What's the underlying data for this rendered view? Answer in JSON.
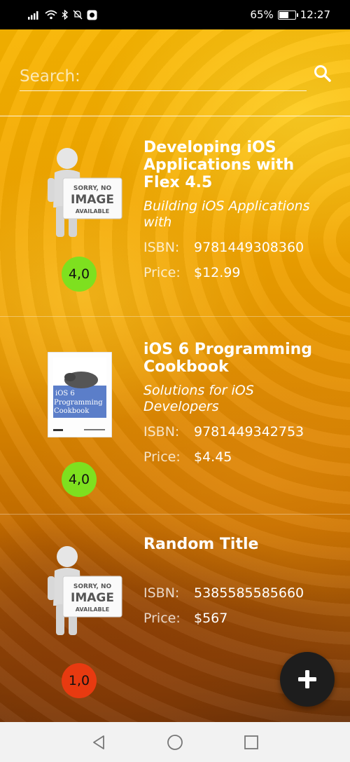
{
  "status_bar": {
    "battery": "65%",
    "battery_level": 0.65,
    "time": "12:27",
    "icons": [
      "signal-icon",
      "wifi-icon",
      "bluetooth-icon",
      "mute-icon",
      "app-notification-icon"
    ]
  },
  "search": {
    "placeholder": "Search:"
  },
  "books": [
    {
      "title": "Developing iOS Applications with Flex 4.5",
      "subtitle": "Building iOS Applications with",
      "isbn_label": "ISBN:",
      "isbn": "9781449308360",
      "price_label": "Price:",
      "price": "$12.99",
      "rating": "4,0",
      "rating_color": "#7ee01f",
      "cover": "no-image-placeholder",
      "cover_text": [
        "SORRY, NO",
        "IMAGE",
        "AVAILABLE"
      ]
    },
    {
      "title": "iOS 6 Programming Cookbook",
      "subtitle": "Solutions for iOS Developers",
      "isbn_label": "ISBN:",
      "isbn": "9781449342753",
      "price_label": "Price:",
      "price": "$4.45",
      "rating": "4,0",
      "rating_color": "#7ee01f",
      "cover": "book-cover",
      "cover_text": [
        "iOS 6",
        "Programming",
        "Cookbook"
      ]
    },
    {
      "title": "Random Title",
      "subtitle": "",
      "isbn_label": "ISBN:",
      "isbn": "5385585585660",
      "price_label": "Price:",
      "price": "$567",
      "rating": "1,0",
      "rating_color": "#e83a10",
      "cover": "no-image-placeholder",
      "cover_text": [
        "SORRY, NO",
        "IMAGE",
        "AVAILABLE"
      ]
    }
  ],
  "fab": {
    "icon": "plus-icon"
  },
  "nav": {
    "icons": [
      "back-icon",
      "home-icon",
      "recents-icon"
    ]
  }
}
